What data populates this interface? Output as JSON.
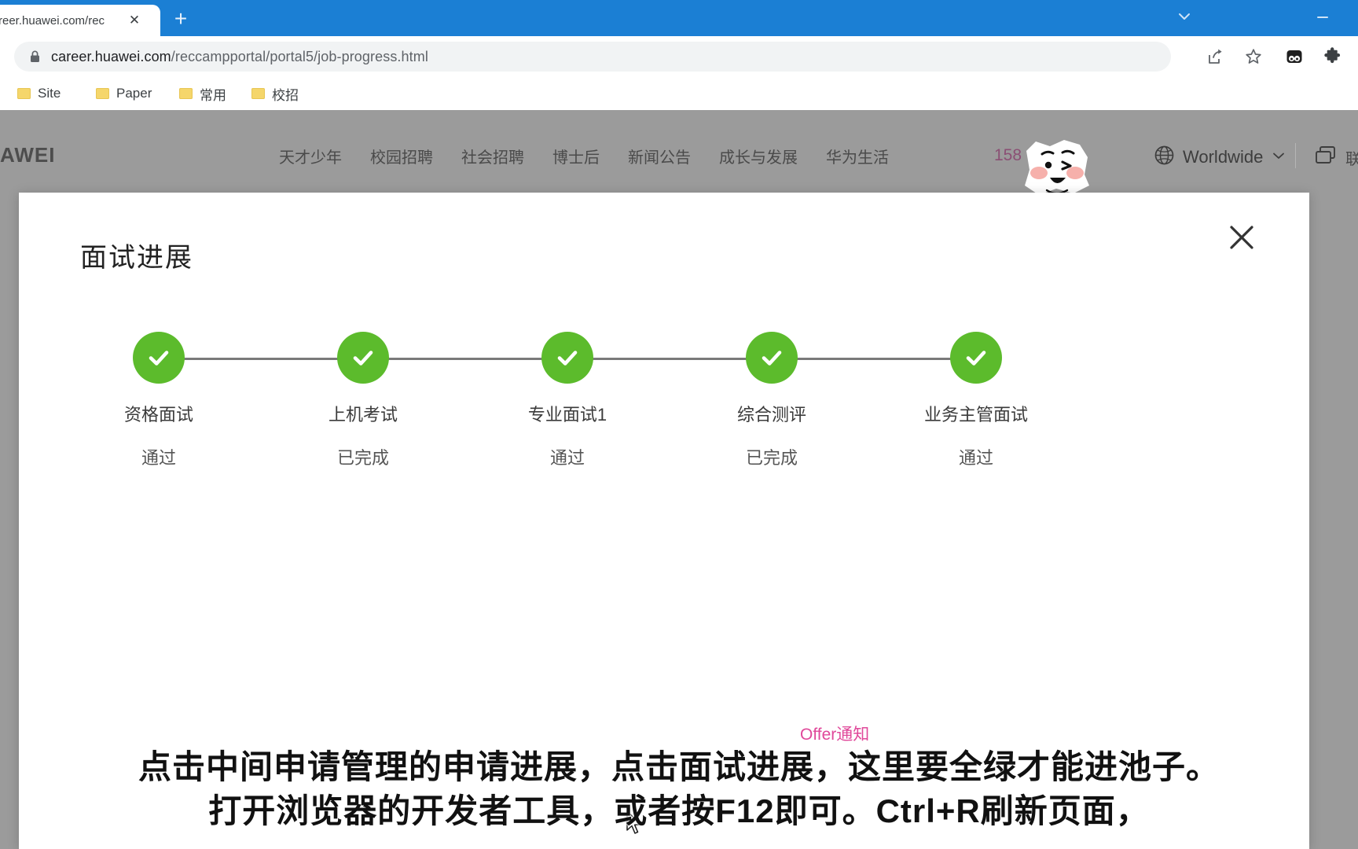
{
  "browser": {
    "tab": {
      "title": "reer.huawei.com/rec",
      "close_label": "✕"
    },
    "new_tab_label": "+",
    "window_controls": {
      "tab_search": "tab-search-chevron",
      "minimize": "–"
    },
    "omnibox": {
      "lock_icon": "lock-icon",
      "url_host": "career.huawei.com",
      "url_path": "/reccampportal/portal5/job-progress.html"
    },
    "toolbar_icons": [
      "share-icon",
      "star-icon",
      "extension-eyes-icon",
      "puzzle-icon"
    ],
    "bookmarks": [
      {
        "label": "Site"
      },
      {
        "label": "Paper"
      },
      {
        "label": "常用"
      },
      {
        "label": "校招"
      }
    ]
  },
  "site": {
    "logo": "AWEI",
    "nav_items": [
      {
        "label": "天才少年"
      },
      {
        "label": "校园招聘"
      },
      {
        "label": "社会招聘"
      },
      {
        "label": "博士后"
      },
      {
        "label": "新闻公告"
      },
      {
        "label": "成长与发展"
      },
      {
        "label": "华为生活"
      }
    ],
    "phone_partial": "158",
    "sticker": "winking-face-sticker",
    "region": {
      "icon": "globe-icon",
      "label": "Worldwide",
      "chevron": "chevron-down-icon"
    },
    "chat_icon": "chat-bubbles-icon",
    "nav_tail": "联"
  },
  "modal": {
    "title": "面试进展",
    "close_label": "✕",
    "steps": [
      {
        "label": "资格面试",
        "status": "通过",
        "state": "done",
        "icon": "check-icon"
      },
      {
        "label": "上机考试",
        "status": "已完成",
        "state": "done",
        "icon": "check-icon"
      },
      {
        "label": "专业面试1",
        "status": "通过",
        "state": "done",
        "icon": "check-icon"
      },
      {
        "label": "综合测评",
        "status": "已完成",
        "state": "done",
        "icon": "check-icon"
      },
      {
        "label": "业务主管面试",
        "status": "通过",
        "state": "done",
        "icon": "check-icon"
      }
    ]
  },
  "background_text": {
    "offer_note": "Offer通知"
  },
  "subtitles": {
    "line1": "点击中间申请管理的申请进展，点击面试进展，这里要全绿才能进池子。",
    "line2": "打开浏览器的开发者工具，或者按F12即可。Ctrl+R刷新页面，"
  },
  "colors": {
    "chrome_blue": "#1b7fd4",
    "step_green": "#5cbb2c",
    "offer_pink": "#e0489a",
    "page_gray": "#9b9b9b"
  }
}
